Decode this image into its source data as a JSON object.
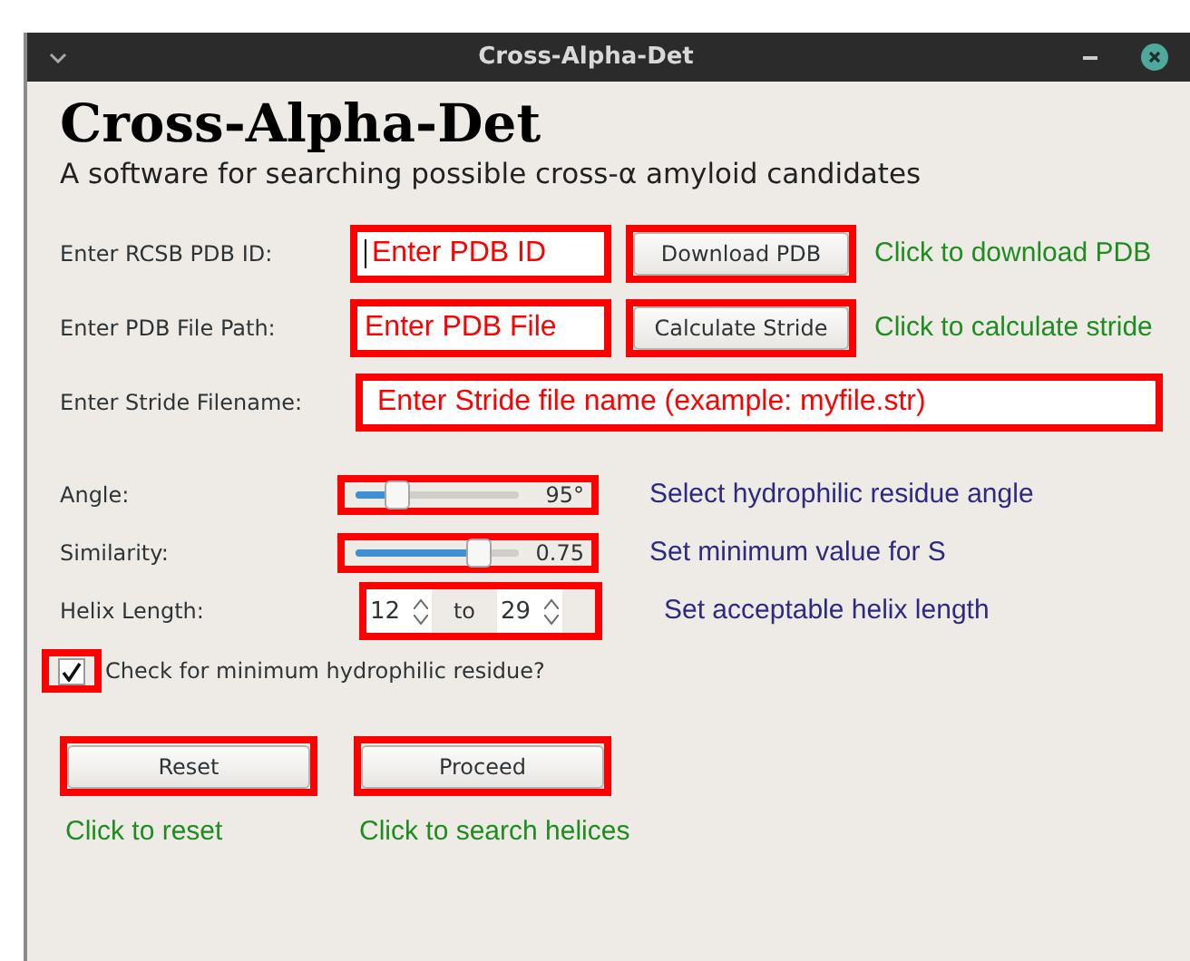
{
  "window": {
    "title": "Cross-Alpha-Det"
  },
  "heading": "Cross-Alpha-Det",
  "subtitle": "A software for searching possible cross-α amyloid candidates",
  "file_rows": [
    {
      "kind": "field_button",
      "label": "Enter RCSB PDB ID:",
      "annotation": "Enter PDB ID",
      "focused": true,
      "button": "Download PDB",
      "note": "Click to download PDB"
    },
    {
      "kind": "field_button",
      "label": "Enter PDB File Path:",
      "annotation": "Enter PDB File",
      "focused": false,
      "button": "Calculate Stride",
      "note": "Click to calculate stride"
    },
    {
      "kind": "wide_field",
      "label": "Enter Stride Filename:",
      "annotation": "Enter Stride file name (example: myfile.str)",
      "focused": false
    }
  ],
  "params": [
    {
      "kind": "slider",
      "label": "Angle:",
      "level": 0.26,
      "reading": "95°",
      "note": "Select hydrophilic residue angle"
    },
    {
      "kind": "slider",
      "label": "Similarity:",
      "level": 0.75,
      "reading": "0.75",
      "note": "Set minimum value for S"
    },
    {
      "kind": "range",
      "label": "Helix Length:",
      "from": "12",
      "separator": "to",
      "to": "29",
      "note": "Set acceptable helix length"
    }
  ],
  "checkbox": {
    "label": "Check for minimum hydrophilic residue?",
    "checked": true
  },
  "actions": [
    {
      "label": "Reset",
      "note": "Click to reset"
    },
    {
      "label": "Proceed",
      "note": "Click to search helices"
    }
  ]
}
